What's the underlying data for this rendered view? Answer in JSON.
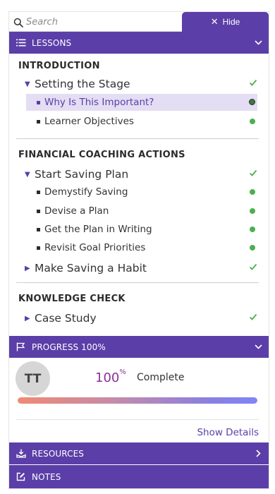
{
  "search": {
    "placeholder": "Search",
    "value": ""
  },
  "hide_button": {
    "label": "Hide",
    "icon": "close-icon"
  },
  "lessons_header": {
    "label": "LESSONS",
    "icon": "list-icon",
    "toggle_icon": "chevron-down-icon"
  },
  "modules": [
    {
      "title": "INTRODUCTION",
      "lessons": [
        {
          "title": "Setting the Stage",
          "expanded": true,
          "completed": true,
          "topics": [
            {
              "title": "Why Is This Important?",
              "active": true,
              "completed": true
            },
            {
              "title": "Learner Objectives",
              "active": false,
              "completed": true
            }
          ]
        }
      ]
    },
    {
      "title": "FINANCIAL COACHING ACTIONS",
      "lessons": [
        {
          "title": "Start Saving Plan",
          "expanded": true,
          "completed": true,
          "topics": [
            {
              "title": "Demystify Saving",
              "active": false,
              "completed": true
            },
            {
              "title": "Devise a Plan",
              "active": false,
              "completed": true
            },
            {
              "title": "Get the Plan in Writing",
              "active": false,
              "completed": true
            },
            {
              "title": "Revisit Goal Priorities",
              "active": false,
              "completed": true
            }
          ]
        },
        {
          "title": "Make Saving a Habit",
          "expanded": false,
          "completed": true,
          "topics": []
        }
      ]
    },
    {
      "title": "KNOWLEDGE CHECK",
      "lessons": [
        {
          "title": "Case Study",
          "expanded": false,
          "completed": true,
          "topics": []
        }
      ]
    }
  ],
  "progress": {
    "header_label": "PROGRESS 100%",
    "header_icon": "flag-icon",
    "toggle_icon": "chevron-down-icon",
    "avatar_initials": "TT",
    "percent_number": "100",
    "percent_sign": "%",
    "complete_label": "Complete",
    "fraction": 1.0,
    "show_details_label": "Show Details"
  },
  "resources": {
    "label": "RESOURCES",
    "icon": "download-tray-icon",
    "toggle_icon": "chevron-right-icon"
  },
  "notes": {
    "label": "NOTES",
    "icon": "edit-note-icon"
  },
  "colors": {
    "accent": "#5b3ea8",
    "active_row_bg": "#e3def3",
    "complete_green": "#4caf50",
    "percent_text": "#8e2e9a"
  }
}
